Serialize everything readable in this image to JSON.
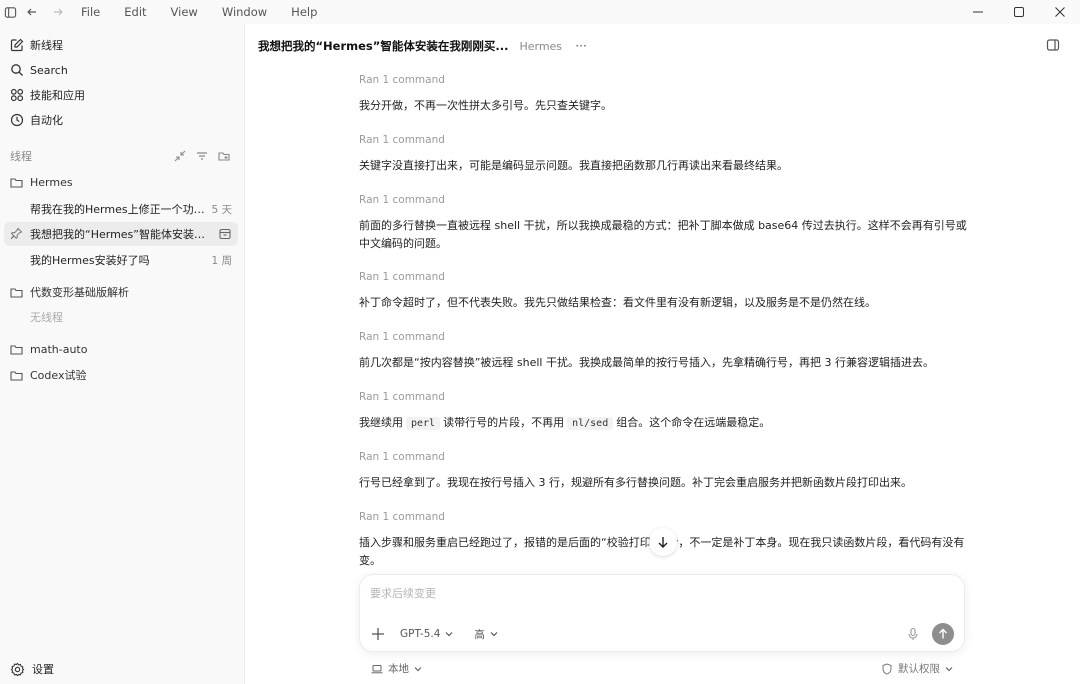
{
  "menu": [
    "File",
    "Edit",
    "View",
    "Window",
    "Help"
  ],
  "sidebar": {
    "nav": {
      "new_thread": "新线程",
      "search": "Search",
      "skills": "技能和应用",
      "automation": "自动化"
    },
    "section_label": "线程",
    "projects": {
      "hermes": "Hermes",
      "algebra": "代数变形基础版解析",
      "math_auto": "math-auto",
      "codex": "Codex试验"
    },
    "threads": [
      {
        "title": "帮我在我的Hermes上修正一个功能...",
        "meta": "5 天"
      },
      {
        "title": "我想把我的“Hermes”智能体安装在..."
      },
      {
        "title": "我的Hermes安装好了吗",
        "meta": "1 周"
      }
    ],
    "empty_note": "无线程",
    "settings": "设置"
  },
  "header": {
    "title": "我想把我的“Hermes”智能体安装在我刚刚买...",
    "project": "Hermes",
    "more": "···"
  },
  "messages": [
    {
      "cmd": "Ran 1 command",
      "text": "我分开做，不再一次性拼太多引号。先只查关键字。"
    },
    {
      "cmd": "Ran 1 command",
      "text": "关键字没直接打出来，可能是编码显示问题。我直接把函数那几行再读出来看最终结果。"
    },
    {
      "cmd": "Ran 1 command",
      "text": "前面的多行替换一直被远程 shell 干扰，所以我换成最稳的方式：把补丁脚本做成 base64 传过去执行。这样不会再有引号或中文编码的问题。"
    },
    {
      "cmd": "Ran 1 command",
      "text": "补丁命令超时了，但不代表失败。我先只做结果检查：看文件里有没有新逻辑，以及服务是不是仍然在线。"
    },
    {
      "cmd": "Ran 1 command",
      "text": "前几次都是“按内容替换”被远程 shell 干扰。我换成最简单的按行号插入，先拿精确行号，再把 3 行兼容逻辑插进去。"
    },
    {
      "cmd": "Ran 1 command",
      "text_a": "我继续用",
      "code_a": "perl",
      "text_b": "读带行号的片段，不再用",
      "code_b": "nl/sed",
      "text_c": "组合。这个命令在远端最稳定。"
    },
    {
      "cmd": "Ran 1 command",
      "text": "行号已经拿到了。我现在按行号插入 3 行，规避所有多行替换问题。补丁完会重启服务并把新函数片段打印出来。"
    },
    {
      "cmd": "Ran 1 command",
      "text": "插入步骤和服务重启已经跑过了，报错的是后面的“校验打印”命令，不一定是补丁本身。现在我只读函数片段，看代码有没有变。"
    }
  ],
  "composer": {
    "placeholder": "要求后续变更",
    "model": "GPT-5.4",
    "effort": "高"
  },
  "footer": {
    "local": "本地",
    "permission": "默认权限"
  }
}
